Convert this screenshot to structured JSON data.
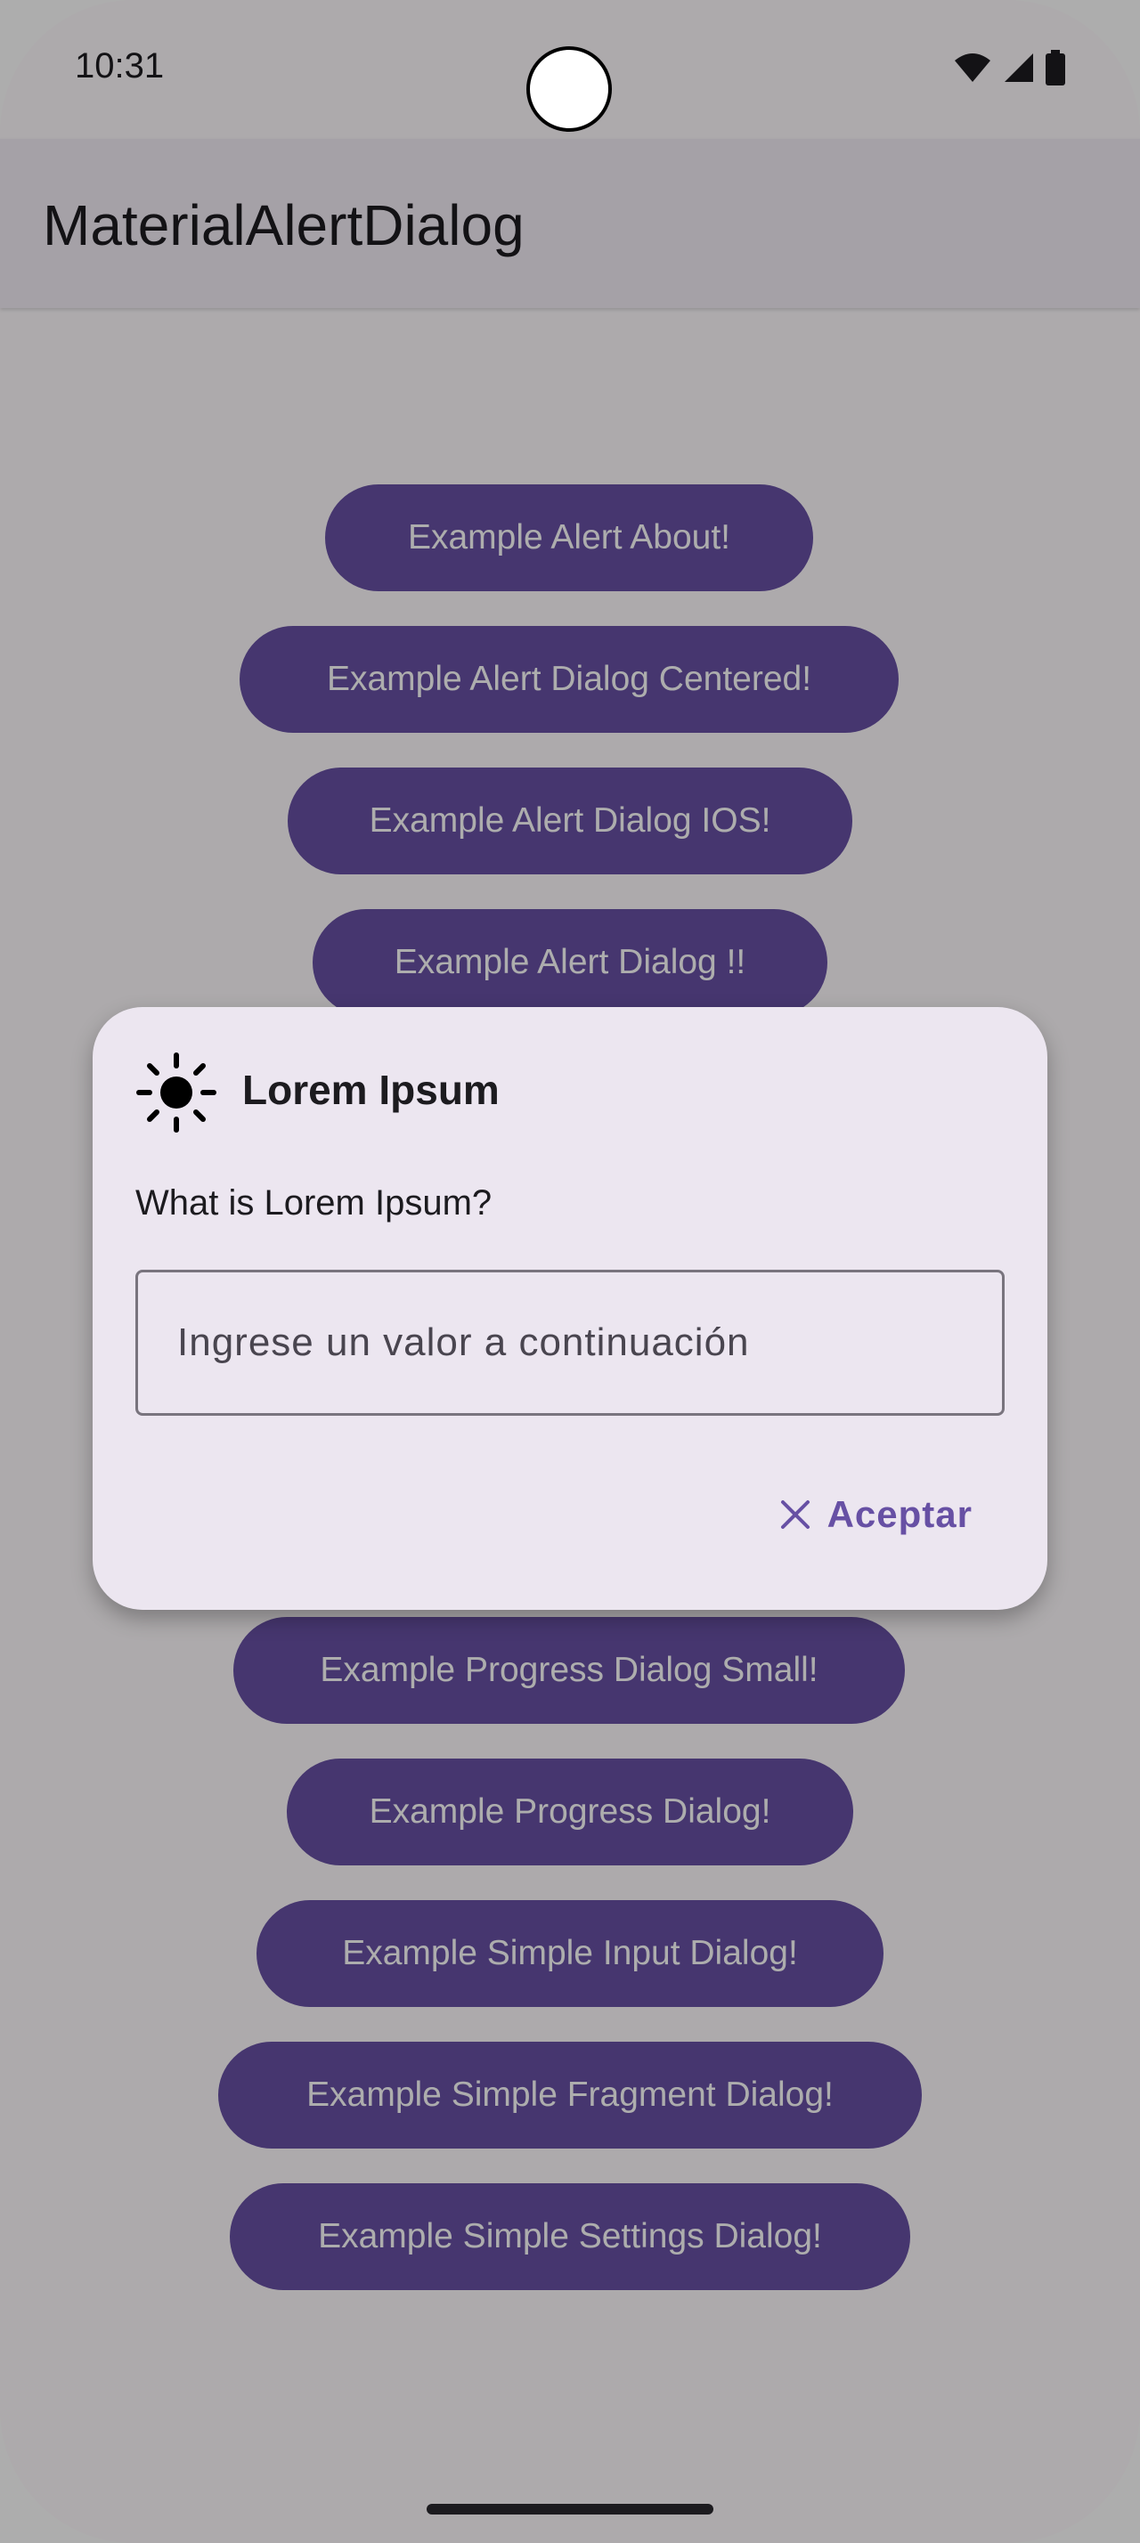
{
  "status_bar": {
    "time": "10:31"
  },
  "app_bar": {
    "title": "MaterialAlertDialog"
  },
  "buttons": [
    "Example Alert About!",
    "Example Alert Dialog Centered!",
    "Example Alert Dialog IOS!",
    "Example Alert Dialog !!",
    "Example Progress Dialog Small!",
    "Example Progress Dialog!",
    "Example Simple Input Dialog!",
    "Example Simple Fragment Dialog!",
    "Example Simple Settings Dialog!"
  ],
  "dialog": {
    "icon": "sun-icon",
    "title": "Lorem Ipsum",
    "message": "What is Lorem Ipsum?",
    "input_placeholder": "Ingrese un valor a continuación",
    "input_value": "",
    "accept_icon": "close-icon",
    "accept_label": "Aceptar"
  },
  "colors": {
    "primary": "#6750a4",
    "surface": "#fffbfe",
    "dialog_surface": "#ece6f0",
    "scrim": "rgba(0,0,0,0.32)"
  }
}
